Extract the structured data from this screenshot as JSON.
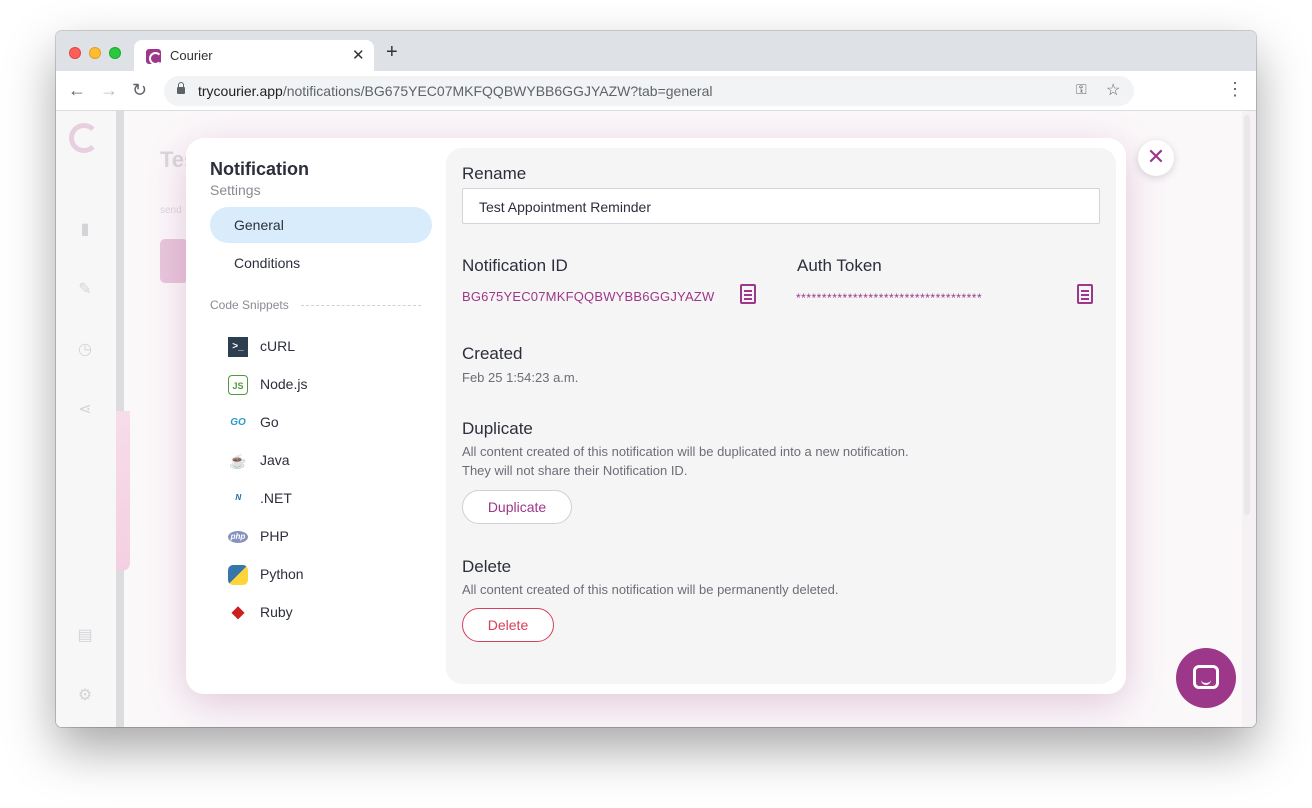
{
  "browser": {
    "tab_title": "Courier",
    "url_host": "trycourier.app",
    "url_path": "/notifications/BG675YEC07MKFQQBWYBB6GGJYAZW?tab=general"
  },
  "background": {
    "page_title": "Tes",
    "page_sub": "send"
  },
  "modal": {
    "title": "Notification",
    "subtitle": "Settings",
    "nav": [
      {
        "label": "General",
        "active": true
      },
      {
        "label": "Conditions",
        "active": false
      }
    ],
    "snippets_heading": "Code Snippets",
    "snippets": [
      {
        "label": "cURL",
        "icon": "terminal-icon"
      },
      {
        "label": "Node.js",
        "icon": "nodejs-icon"
      },
      {
        "label": "Go",
        "icon": "go-icon"
      },
      {
        "label": "Java",
        "icon": "java-icon"
      },
      {
        "label": ".NET",
        "icon": "dotnet-icon"
      },
      {
        "label": "PHP",
        "icon": "php-icon"
      },
      {
        "label": "Python",
        "icon": "python-icon"
      },
      {
        "label": "Ruby",
        "icon": "ruby-icon"
      }
    ],
    "rename_label": "Rename",
    "rename_value": "Test Appointment Reminder",
    "notification_id_label": "Notification ID",
    "notification_id_value": "BG675YEC07MKFQQBWYBB6GGJYAZW",
    "auth_token_label": "Auth Token",
    "auth_token_value": "************************************",
    "created_label": "Created",
    "created_value": "Feb 25 1:54:23 a.m.",
    "duplicate_label": "Duplicate",
    "duplicate_desc_1": "All content created of this notification will be duplicated into a new notification.",
    "duplicate_desc_2": "They will not share their Notification ID.",
    "duplicate_button": "Duplicate",
    "delete_label": "Delete",
    "delete_desc": "All content created of this notification will be permanently deleted.",
    "delete_button": "Delete"
  },
  "colors": {
    "brand": "#9d3789",
    "danger": "#d63e5a",
    "active_nav": "#d9ecfb"
  }
}
